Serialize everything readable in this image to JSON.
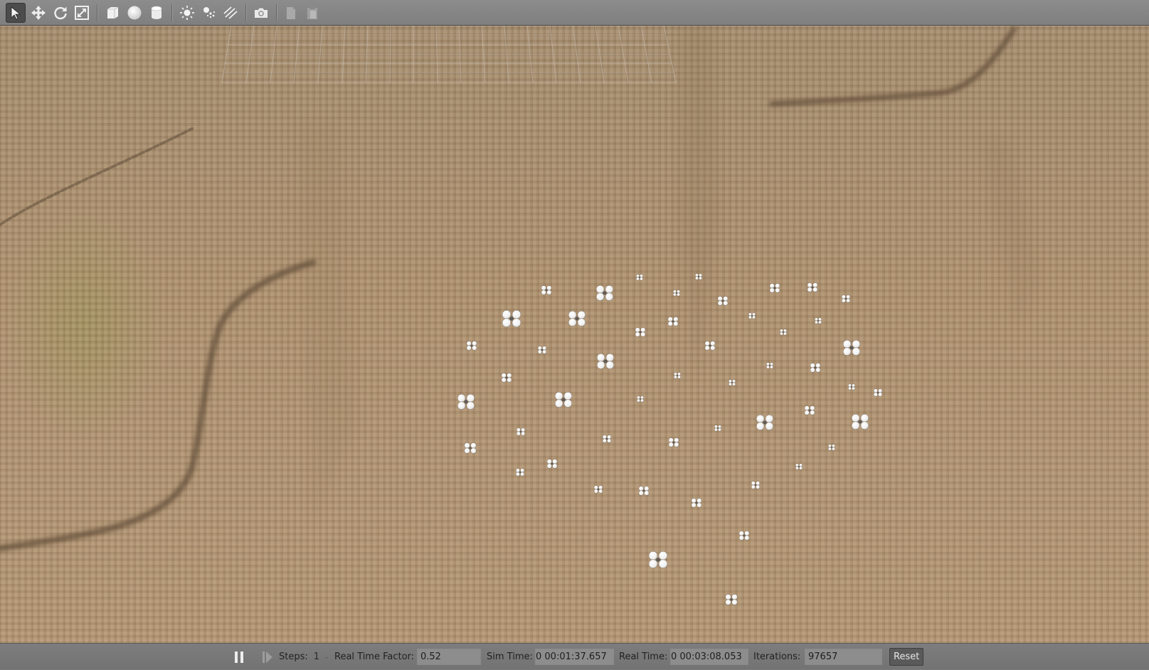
{
  "toolbar": {
    "tools": [
      {
        "icon": "select-arrow-icon",
        "active": true
      },
      {
        "icon": "translate-move-icon"
      },
      {
        "icon": "rotate-icon"
      },
      {
        "icon": "scale-icon"
      },
      {
        "icon": "box-shape-icon"
      },
      {
        "icon": "sphere-shape-icon"
      },
      {
        "icon": "cylinder-shape-icon"
      },
      {
        "icon": "point-light-icon"
      },
      {
        "icon": "spot-light-icon"
      },
      {
        "icon": "directional-light-icon"
      },
      {
        "icon": "screenshot-camera-icon"
      },
      {
        "icon": "copy-icon"
      },
      {
        "icon": "paste-icon"
      }
    ]
  },
  "colors": {
    "ground": "#ad9170",
    "toolbar": "#868686",
    "drone": "#f4f4f4"
  },
  "status": {
    "pause_icon": "pause-icon",
    "step_icon": "step-forward-icon",
    "steps_label": "Steps:",
    "steps_value": "1",
    "rtf_label": "Real Time Factor:",
    "rtf_value": "0.52",
    "sim_time_label": "Sim Time:",
    "sim_time_value": "0 00:01:37.657",
    "real_time_label": "Real Time:",
    "real_time_value": "0 00:03:08.053",
    "iterations_label": "Iterations:",
    "iterations_value": "97657",
    "reset_label": "Reset"
  }
}
